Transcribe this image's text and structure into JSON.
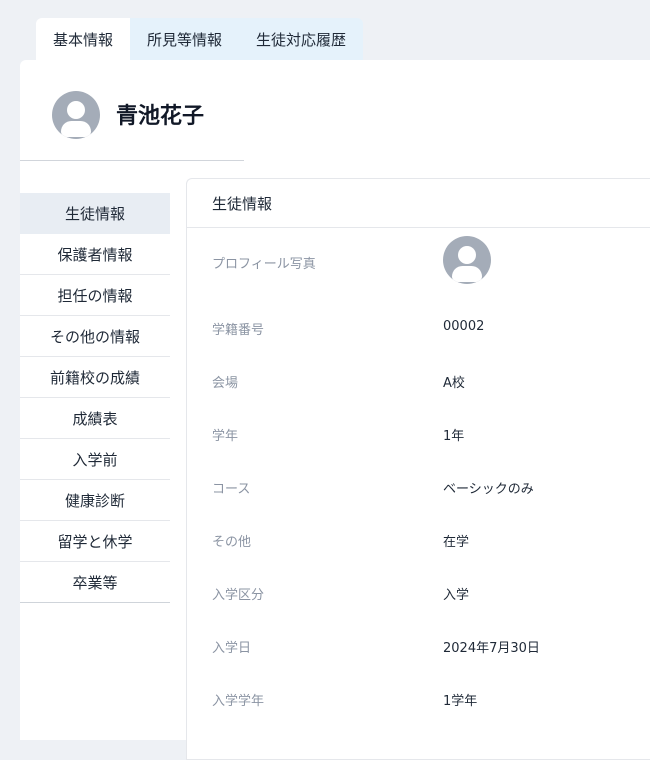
{
  "tabs": [
    {
      "label": "基本情報",
      "active": true
    },
    {
      "label": "所見等情報",
      "active": false
    },
    {
      "label": "生徒対応履歴",
      "active": false
    }
  ],
  "student": {
    "name": "青池花子",
    "avatar_icon": "user-avatar-icon"
  },
  "sidemenu": [
    {
      "label": "生徒情報",
      "active": true
    },
    {
      "label": "保護者情報"
    },
    {
      "label": "担任の情報"
    },
    {
      "label": "その他の情報"
    },
    {
      "label": "前籍校の成績"
    },
    {
      "label": "成績表"
    },
    {
      "label": "入学前"
    },
    {
      "label": "健康診断"
    },
    {
      "label": "留学と休学"
    },
    {
      "label": "卒業等"
    }
  ],
  "info": {
    "title": "生徒情報",
    "photo_label": "プロフィール写真",
    "rows": [
      {
        "label": "学籍番号",
        "value": "00002"
      },
      {
        "label": "会場",
        "value": "A校"
      },
      {
        "label": "学年",
        "value": "1年"
      },
      {
        "label": "コース",
        "value": "ベーシックのみ"
      },
      {
        "label": "その他",
        "value": "在学"
      },
      {
        "label": "入学区分",
        "value": "入学"
      },
      {
        "label": "入学日",
        "value": "2024年7月30日"
      },
      {
        "label": "入学学年",
        "value": "1学年"
      }
    ]
  },
  "colors": {
    "background": "#eef1f5",
    "tab_inactive": "#e5f2fb",
    "menu_active": "#e8edf3",
    "label_text": "#8b94a3",
    "avatar": "#a4acb8"
  }
}
